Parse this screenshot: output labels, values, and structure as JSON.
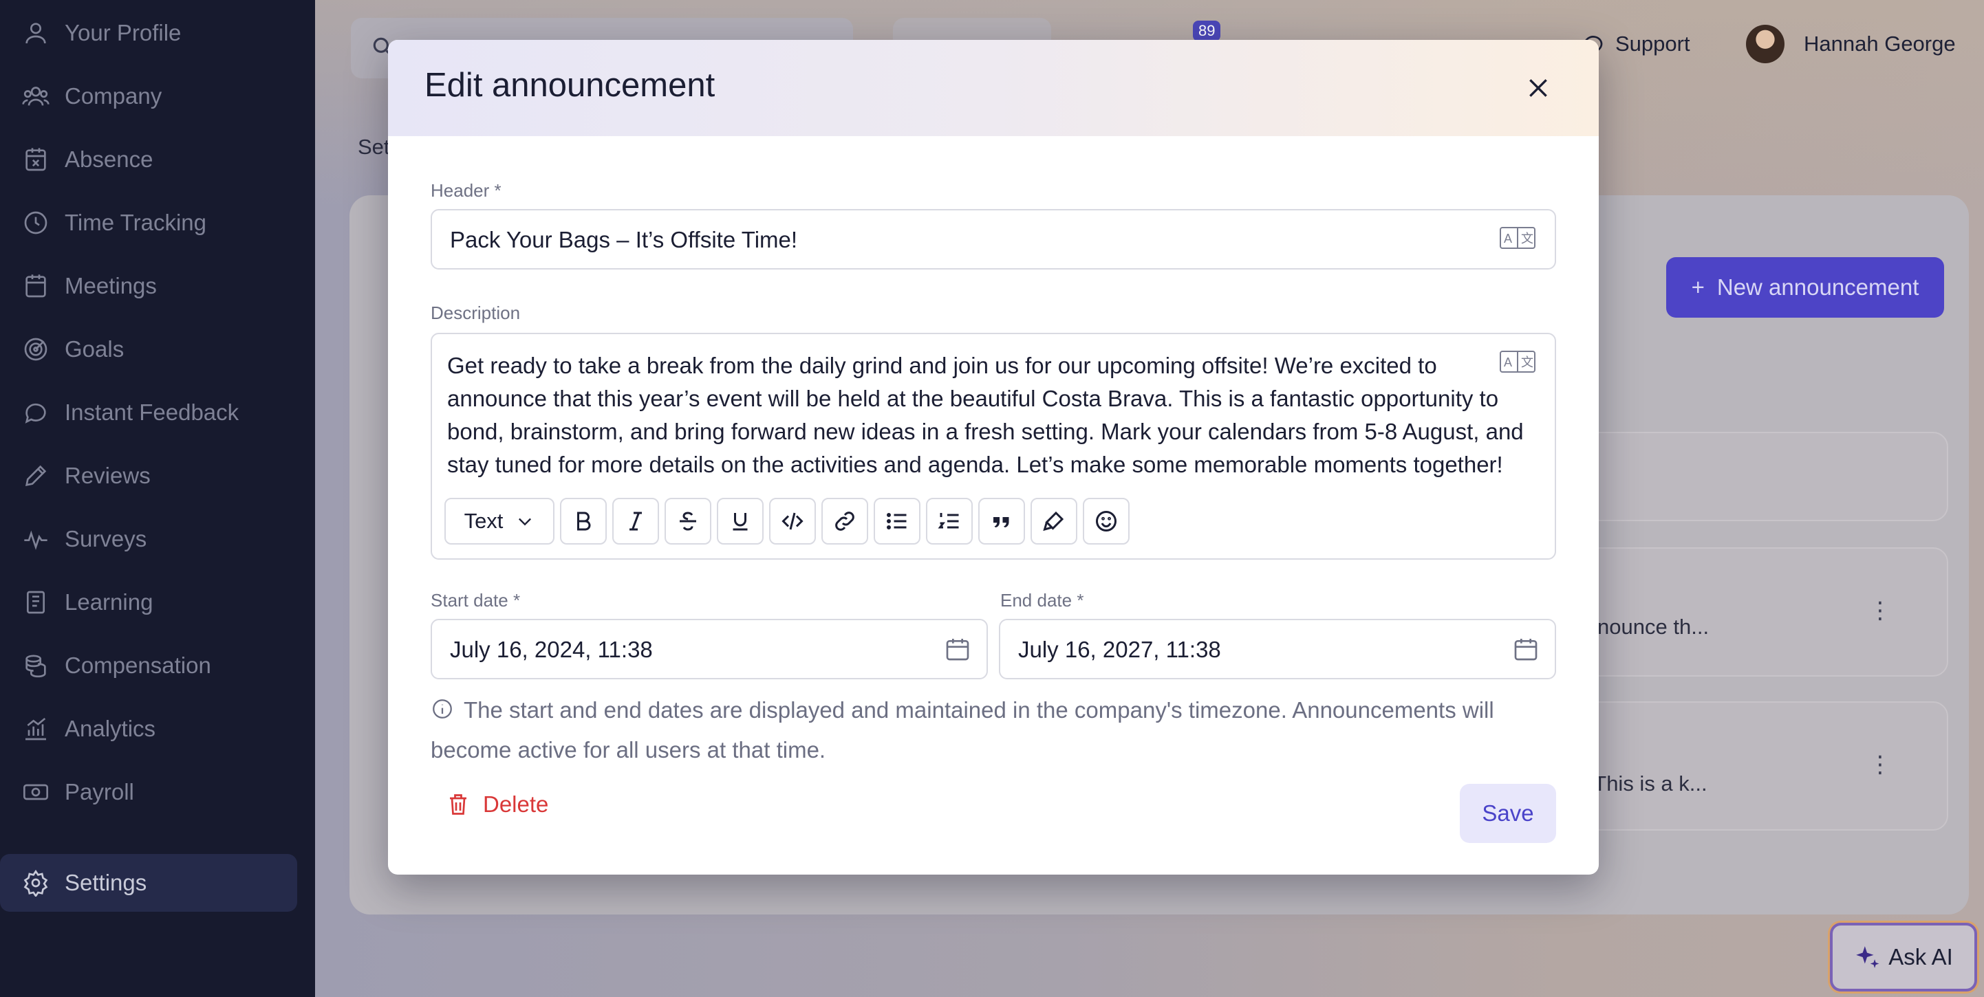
{
  "sidebar": {
    "items": [
      {
        "label": "Your Profile",
        "icon": "user-icon"
      },
      {
        "label": "Company",
        "icon": "users-icon"
      },
      {
        "label": "Absence",
        "icon": "calendar-x-icon"
      },
      {
        "label": "Time Tracking",
        "icon": "clock-icon"
      },
      {
        "label": "Meetings",
        "icon": "calendar-icon"
      },
      {
        "label": "Goals",
        "icon": "target-icon"
      },
      {
        "label": "Instant Feedback",
        "icon": "chat-bubble-icon"
      },
      {
        "label": "Reviews",
        "icon": "pencil-icon"
      },
      {
        "label": "Surveys",
        "icon": "pulse-icon"
      },
      {
        "label": "Learning",
        "icon": "book-icon"
      },
      {
        "label": "Compensation",
        "icon": "coins-icon"
      },
      {
        "label": "Analytics",
        "icon": "bar-chart-icon"
      },
      {
        "label": "Payroll",
        "icon": "banknote-icon"
      }
    ],
    "active_item": {
      "label": "Settings",
      "icon": "gear-icon"
    }
  },
  "topbar": {
    "notification_count": "89",
    "support_label": "Support",
    "user_name": "Hannah George"
  },
  "background": {
    "tab_partial": "Set",
    "new_announcement_label": "New announcement",
    "row1_text": "ed to announce th...",
    "row2_text": "t week. This is a k...",
    "ask_ai_label": "Ask AI"
  },
  "modal": {
    "title": "Edit announcement",
    "header_label": "Header *",
    "header_value": "Pack Your Bags – It’s Offsite Time!",
    "description_label": "Description",
    "description_value": "Get ready to take a break from the daily grind and join us for our upcoming offsite! We’re excited to announce that this year’s event will be held at the beautiful Costa Brava. This is a fantastic opportunity to bond, brainstorm, and bring forward new ideas in a fresh setting. Mark your calendars from 5-8 August, and stay tuned for more details on the activities and agenda. Let’s make some memorable moments together!",
    "toolbar": {
      "format_select": "Text",
      "buttons": [
        "bold-icon",
        "italic-icon",
        "strikethrough-icon",
        "underline-icon",
        "code-icon",
        "link-icon",
        "bullet-list-icon",
        "numbered-list-icon",
        "quote-icon",
        "highlighter-icon",
        "emoji-icon"
      ]
    },
    "start_date_label": "Start date *",
    "start_date_value": "July 16, 2024, 11:38",
    "end_date_label": "End date *",
    "end_date_value": "July 16, 2027, 11:38",
    "info_text": "The start and end dates are displayed and maintained in the company's timezone. Announcements will become active for all users at that time.",
    "delete_label": "Delete",
    "save_label": "Save"
  },
  "colors": {
    "sidebar_bg": "#171a2e",
    "primary": "#4d44c6",
    "danger": "#d93838"
  }
}
